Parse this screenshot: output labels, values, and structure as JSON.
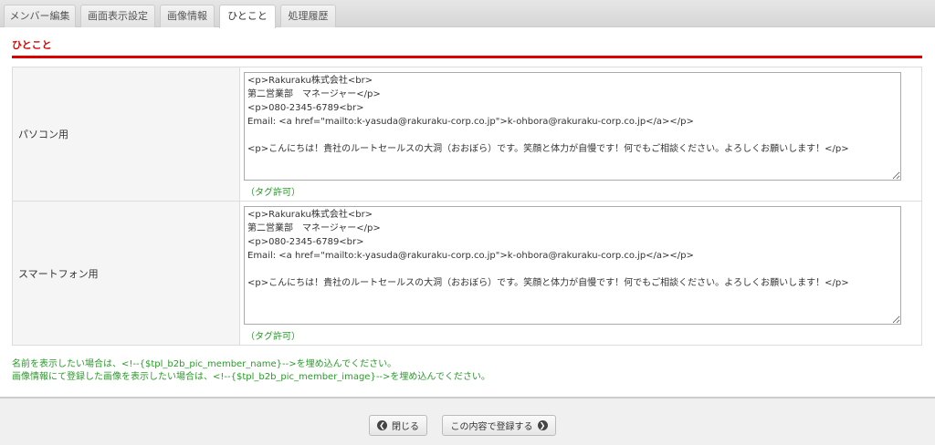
{
  "tabs": [
    {
      "label": "メンバー編集"
    },
    {
      "label": "画面表示設定"
    },
    {
      "label": "画像情報"
    },
    {
      "label": "ひとこと"
    },
    {
      "label": "処理履歴"
    }
  ],
  "section_title": "ひとこと",
  "rows": [
    {
      "label": "パソコン用",
      "value": "<p>Rakuraku株式会社<br>\n第二営業部　マネージャー</p>\n<p>080-2345-6789<br>\nEmail: <a href=\"mailto:k-yasuda@rakuraku-corp.co.jp\">k-ohbora@rakuraku-corp.co.jp</a></p>\n\n<p>こんにちは！貴社のルートセールスの大洞（おおぼら）です。笑顔と体力が自慢です！何でもご相談ください。よろしくお願いします！</p>",
      "note": "（タグ許可）"
    },
    {
      "label": "スマートフォン用",
      "value": "<p>Rakuraku株式会社<br>\n第二営業部　マネージャー</p>\n<p>080-2345-6789<br>\nEmail: <a href=\"mailto:k-yasuda@rakuraku-corp.co.jp\">k-ohbora@rakuraku-corp.co.jp</a></p>\n\n<p>こんにちは！貴社のルートセールスの大洞（おおぼら）です。笑顔と体力が自慢です！何でもご相談ください。よろしくお願いします！</p>",
      "note": "（タグ許可）"
    }
  ],
  "notes": [
    "名前を表示したい場合は、<!--{$tpl_b2b_pic_member_name}-->を埋め込んでください。",
    "画像情報にて登録した画像を表示したい場合は、<!--{$tpl_b2b_pic_member_image}-->を埋め込んでください。"
  ],
  "buttons": {
    "close": "閉じる",
    "submit": "この内容で登録する"
  },
  "colors": {
    "accent": "#dd0000",
    "note": "#2a9a2a"
  }
}
